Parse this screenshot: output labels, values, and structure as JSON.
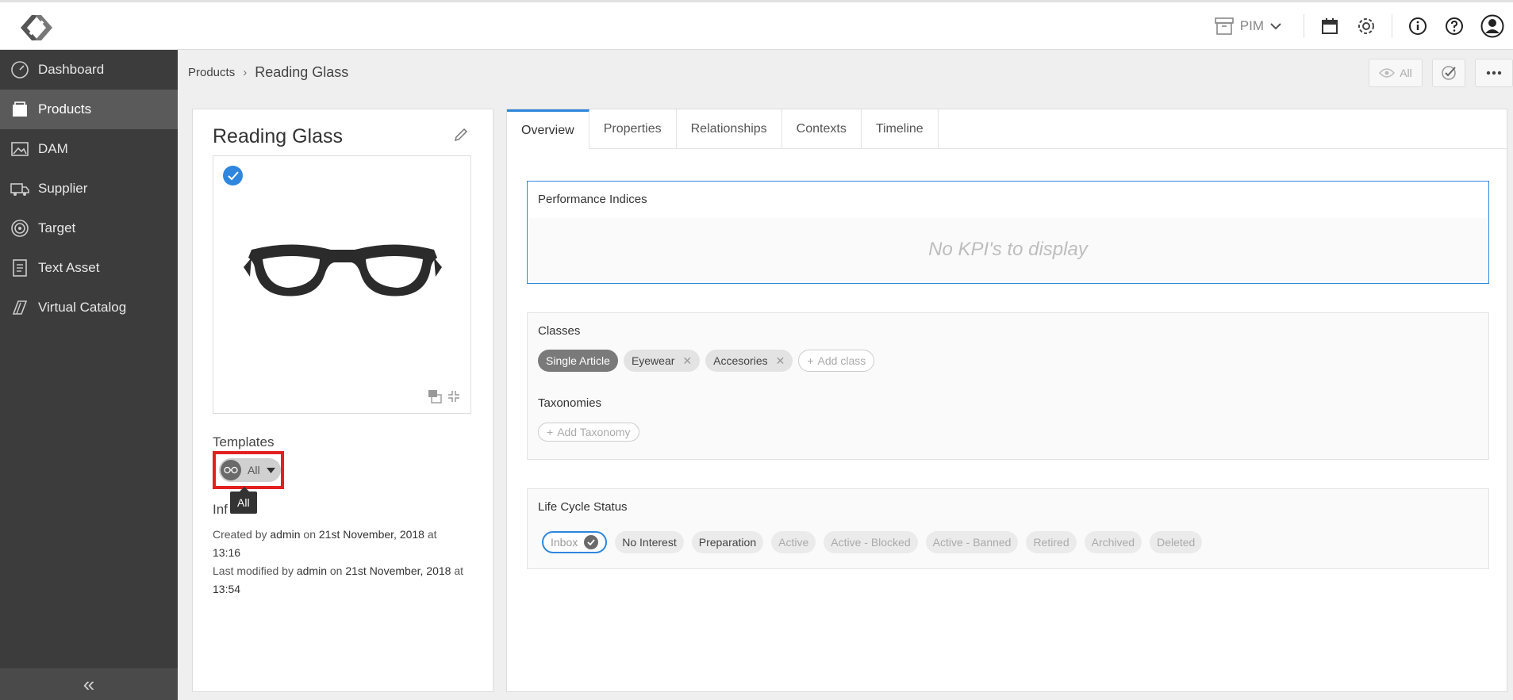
{
  "topbar": {
    "module_label": "PIM",
    "icons": [
      "logo-icon",
      "archive-icon",
      "chevron-down-icon",
      "calendar-icon",
      "gear-icon",
      "info-icon",
      "help-icon",
      "user-icon"
    ]
  },
  "sidebar": {
    "items": [
      {
        "label": "Dashboard",
        "icon": "dashboard-icon"
      },
      {
        "label": "Products",
        "icon": "products-icon",
        "active": true
      },
      {
        "label": "DAM",
        "icon": "image-icon"
      },
      {
        "label": "Supplier",
        "icon": "truck-icon"
      },
      {
        "label": "Target",
        "icon": "target-icon"
      },
      {
        "label": "Text Asset",
        "icon": "document-icon"
      },
      {
        "label": "Virtual Catalog",
        "icon": "catalog-icon"
      }
    ],
    "collapse_label": "«"
  },
  "breadcrumb": {
    "parent": "Products",
    "separator": "›",
    "current": "Reading Glass",
    "view_label": "All"
  },
  "product": {
    "title": "Reading Glass",
    "templates_label": "Templates",
    "template_value": "All",
    "tooltip": "All",
    "info_label": "Inf",
    "created_prefix": "Created by",
    "created_by": "admin",
    "created_on_word": "on",
    "created_date": "21st November, 2018",
    "created_at_word": "at",
    "created_time": "13:16",
    "modified_prefix": "Last modified by",
    "modified_by": "admin",
    "modified_on_word": "on",
    "modified_date": "21st November, 2018",
    "modified_at_word": "at",
    "modified_time": "13:54"
  },
  "tabs": [
    "Overview",
    "Properties",
    "Relationships",
    "Contexts",
    "Timeline"
  ],
  "kpi": {
    "title": "Performance Indices",
    "empty": "No KPI's to display"
  },
  "classes": {
    "title": "Classes",
    "items": [
      "Single Article",
      "Eyewear",
      "Accesories"
    ],
    "add_label": "Add class",
    "taxonomies_title": "Taxonomies",
    "add_taxonomy_label": "Add Taxonomy"
  },
  "lifecycle": {
    "title": "Life Cycle Status",
    "items": [
      "Inbox",
      "No Interest",
      "Preparation",
      "Active",
      "Active - Blocked",
      "Active - Banned",
      "Retired",
      "Archived",
      "Deleted"
    ]
  },
  "colors": {
    "accent": "#2e86de",
    "sidebar": "#3c3c3c",
    "highlight": "#e32020"
  }
}
